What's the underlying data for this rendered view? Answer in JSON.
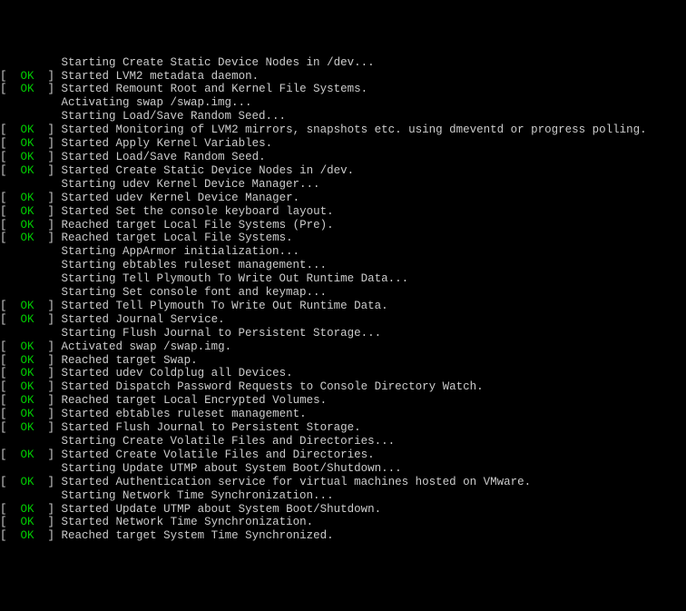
{
  "boot_lines": [
    {
      "status": null,
      "msg": "Starting Create Static Device Nodes in /dev..."
    },
    {
      "status": "OK",
      "msg": "Started LVM2 metadata daemon."
    },
    {
      "status": "OK",
      "msg": "Started Remount Root and Kernel File Systems."
    },
    {
      "status": null,
      "msg": "Activating swap /swap.img..."
    },
    {
      "status": null,
      "msg": "Starting Load/Save Random Seed..."
    },
    {
      "status": "OK",
      "msg": "Started Monitoring of LVM2 mirrors, snapshots etc. using dmeventd or progress polling."
    },
    {
      "status": "OK",
      "msg": "Started Apply Kernel Variables."
    },
    {
      "status": "OK",
      "msg": "Started Load/Save Random Seed."
    },
    {
      "status": "OK",
      "msg": "Started Create Static Device Nodes in /dev."
    },
    {
      "status": null,
      "msg": "Starting udev Kernel Device Manager..."
    },
    {
      "status": "OK",
      "msg": "Started udev Kernel Device Manager."
    },
    {
      "status": "OK",
      "msg": "Started Set the console keyboard layout."
    },
    {
      "status": "OK",
      "msg": "Reached target Local File Systems (Pre)."
    },
    {
      "status": "OK",
      "msg": "Reached target Local File Systems."
    },
    {
      "status": null,
      "msg": "Starting AppArmor initialization..."
    },
    {
      "status": null,
      "msg": "Starting ebtables ruleset management..."
    },
    {
      "status": null,
      "msg": "Starting Tell Plymouth To Write Out Runtime Data..."
    },
    {
      "status": null,
      "msg": "Starting Set console font and keymap..."
    },
    {
      "status": "OK",
      "msg": "Started Tell Plymouth To Write Out Runtime Data."
    },
    {
      "status": "OK",
      "msg": "Started Journal Service."
    },
    {
      "status": null,
      "msg": "Starting Flush Journal to Persistent Storage..."
    },
    {
      "status": "OK",
      "msg": "Activated swap /swap.img."
    },
    {
      "status": "OK",
      "msg": "Reached target Swap."
    },
    {
      "status": "OK",
      "msg": "Started udev Coldplug all Devices."
    },
    {
      "status": "OK",
      "msg": "Started Dispatch Password Requests to Console Directory Watch."
    },
    {
      "status": "OK",
      "msg": "Reached target Local Encrypted Volumes."
    },
    {
      "status": "OK",
      "msg": "Started ebtables ruleset management."
    },
    {
      "status": "OK",
      "msg": "Started Flush Journal to Persistent Storage."
    },
    {
      "status": null,
      "msg": "Starting Create Volatile Files and Directories..."
    },
    {
      "status": "OK",
      "msg": "Started Create Volatile Files and Directories."
    },
    {
      "status": null,
      "msg": "Starting Update UTMP about System Boot/Shutdown..."
    },
    {
      "status": "OK",
      "msg": "Started Authentication service for virtual machines hosted on VMware."
    },
    {
      "status": null,
      "msg": "Starting Network Time Synchronization..."
    },
    {
      "status": "OK",
      "msg": "Started Update UTMP about System Boot/Shutdown."
    },
    {
      "status": "OK",
      "msg": "Started Network Time Synchronization."
    },
    {
      "status": "OK",
      "msg": "Reached target System Time Synchronized."
    }
  ],
  "status_label": "OK",
  "indent": "         "
}
